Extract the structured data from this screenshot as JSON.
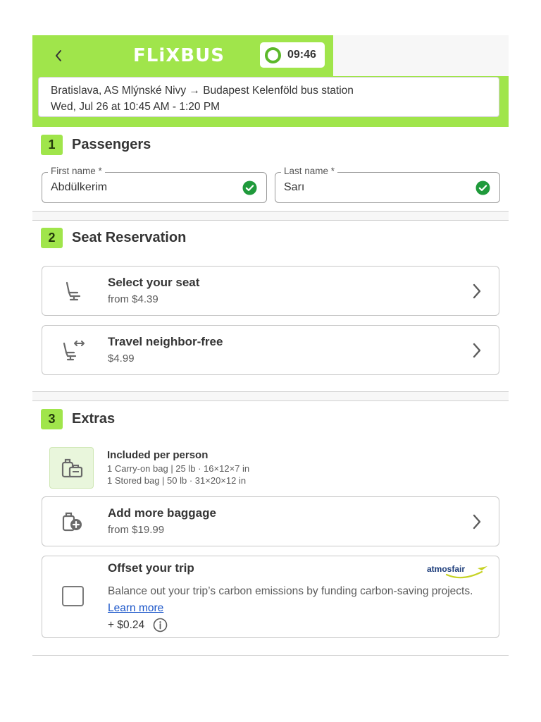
{
  "header": {
    "brand": "FLiXBUS",
    "timer": "09:46",
    "colors": {
      "brand_green": "#a0e54b",
      "timer_ring": "#5cb82a"
    }
  },
  "trip": {
    "route": "Bratislava, AS Mlýnské Nivy → Budapest Kelenföld bus station",
    "datetime": "Wed, Jul 26 at 10:45 AM - 1:20 PM"
  },
  "passengers": {
    "step": "1",
    "title": "Passengers",
    "first_name_label": "First name *",
    "first_name_value": "Abdülkerim",
    "last_name_label": "Last name *",
    "last_name_value": "Sarı"
  },
  "seat": {
    "step": "2",
    "title": "Seat Reservation",
    "options": [
      {
        "title": "Select your seat",
        "price": "from $4.39",
        "icon": "seat-icon"
      },
      {
        "title": "Travel neighbor-free",
        "price": "$4.99",
        "icon": "seat-neighbor-free-icon"
      }
    ]
  },
  "extras": {
    "step": "3",
    "title": "Extras",
    "included": {
      "title": "Included per person",
      "lines": [
        "1 Carry-on bag | 25 lb · 16×12×7 in",
        "1 Stored bag | 50 lb · 31×20×12 in"
      ]
    },
    "baggage": {
      "title": "Add more baggage",
      "price": "from $19.99"
    },
    "offset": {
      "title": "Offset your trip",
      "description": "Balance out your trip’s carbon emissions by funding carbon-saving projects.",
      "link": "Learn more",
      "price": "+ $0.24",
      "partner": "atmosfair"
    }
  }
}
